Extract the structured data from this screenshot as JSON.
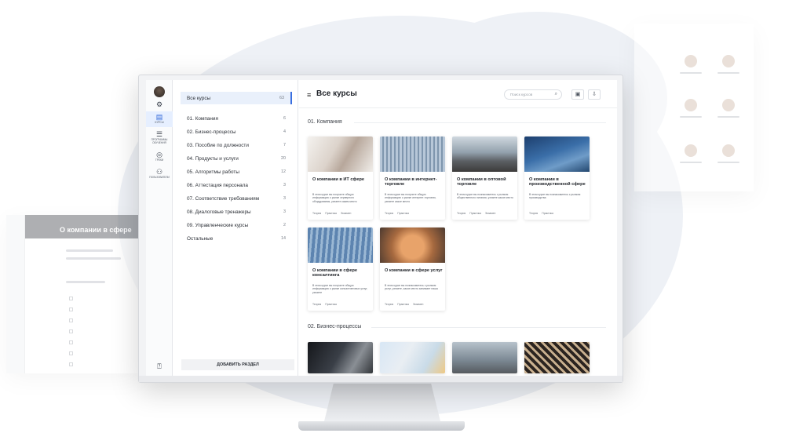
{
  "sidebar": {
    "items": [
      {
        "label": "Все курсы",
        "count": "63"
      },
      {
        "label": "01. Компания",
        "count": "6"
      },
      {
        "label": "02. Бизнес-процессы",
        "count": "4"
      },
      {
        "label": "03. Пособие по должности",
        "count": "7"
      },
      {
        "label": "04. Продукты и услуги",
        "count": "20"
      },
      {
        "label": "05. Алгоритмы работы",
        "count": "12"
      },
      {
        "label": "06. Аттестация персонала",
        "count": "3"
      },
      {
        "label": "07. Соответствие требованиям",
        "count": "3"
      },
      {
        "label": "08. Диалоговые тренажеры",
        "count": "3"
      },
      {
        "label": "09. Управленческие курсы",
        "count": "2"
      },
      {
        "label": "Остальные",
        "count": "14"
      }
    ],
    "add_button": "Добавить раздел"
  },
  "rail": {
    "items": [
      {
        "icon": "book-icon",
        "label": "Курсы"
      },
      {
        "icon": "list-icon",
        "label": "Программы обучения"
      },
      {
        "icon": "compass-icon",
        "label": "Треки"
      },
      {
        "icon": "users-icon",
        "label": "Пользователи"
      }
    ]
  },
  "header": {
    "title": "Все курсы",
    "search_placeholder": "Поиск курсов"
  },
  "sections": [
    {
      "title": "01. Компания",
      "cards": [
        {
          "title": "О компании в ИТ сфере",
          "desc": "В этом курсе вы получите общую информацию о рынке серверного оборудования, узнаете каким место",
          "meta": [
            "Теория",
            "Практика",
            "Экзамен"
          ]
        },
        {
          "title": "О компании в интернет-торговле",
          "desc": "В этом курсе вы получите общую информацию о рынке интернет-торговли, узнаете какое место",
          "meta": [
            "Теория",
            "Практика"
          ]
        },
        {
          "title": "О компании в оптовой торговле",
          "desc": "В этом курсе вы познакомитесь с рынком общественного питания, узнаете какое место",
          "meta": [
            "Теория",
            "Практика",
            "Экзамен"
          ]
        },
        {
          "title": "О компании в производственной сфере",
          "desc": "В этом курсе вы познакомитесь с рынком производства",
          "meta": [
            "Теория",
            "Практика"
          ]
        },
        {
          "title": "О компании в сфере консалтинга",
          "desc": "В этом курсе вы получите общую информацию о рынке консалтинговых услуг, узнаете",
          "meta": [
            "Теория",
            "Практика"
          ]
        },
        {
          "title": "О компании в сфере услуг",
          "desc": "В этом курсе вы познакомитесь с рынком услуг, узнаете, какое место занимает наша",
          "meta": [
            "Теория",
            "Практика",
            "Экзамен"
          ]
        }
      ]
    },
    {
      "title": "02. Бизнес-процессы"
    }
  ],
  "background": {
    "left_title": "О компании в сфере"
  }
}
